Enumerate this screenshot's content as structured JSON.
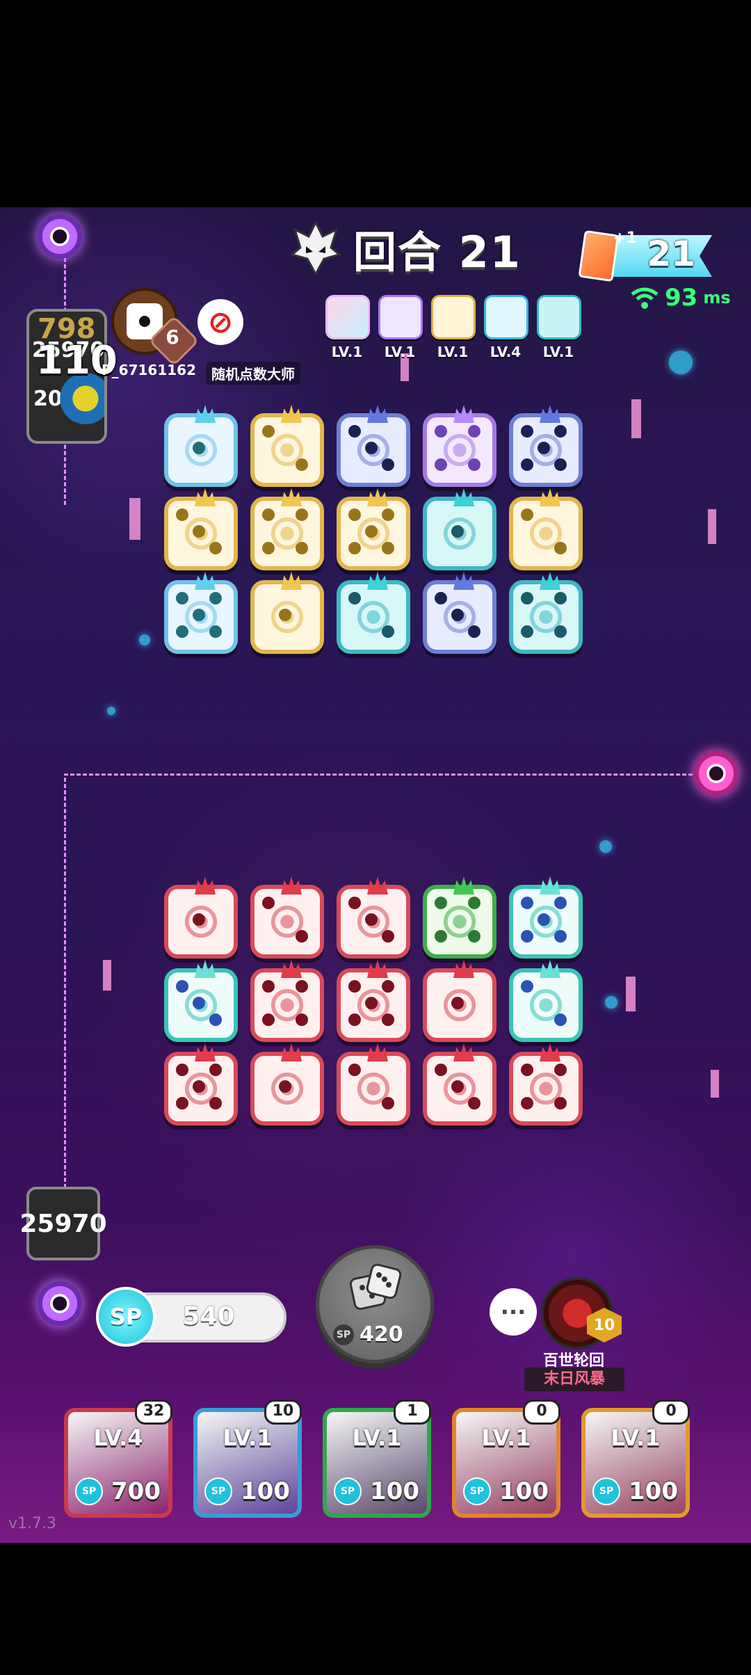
{
  "header": {
    "round_label": "回合 21",
    "card_count": "21",
    "card_bonus": "+1",
    "ping_value": "93",
    "ping_unit": "ms"
  },
  "opponent": {
    "score_top": "798",
    "score_partial": "25970",
    "score_partial_2": "20",
    "hp": "110",
    "rank": "6",
    "name": "P_67161162",
    "title": "随机点数大师",
    "deck_levels": [
      "LV.1",
      "LV.1",
      "LV.1",
      "LV.4",
      "LV.1"
    ],
    "board": [
      [
        "ice",
        "gold",
        "navy",
        "purple",
        "navy"
      ],
      [
        "gold",
        "gold",
        "gold",
        "teal",
        "gold"
      ],
      [
        "ice",
        "gold",
        "teal",
        "navy",
        "teal"
      ]
    ]
  },
  "player": {
    "hp": "25970",
    "sp": "540",
    "roll_cost": "420",
    "emblem_title": "百世轮回",
    "emblem_subtitle": "末日风暴",
    "emblem_level": "10",
    "chat_label": "···",
    "board": [
      [
        "red",
        "red",
        "red",
        "green",
        "mint"
      ],
      [
        "mint",
        "red",
        "red",
        "red",
        "mint"
      ],
      [
        "red",
        "red",
        "red",
        "red",
        "red"
      ]
    ],
    "deck": [
      {
        "level": "LV.4",
        "cost": "700",
        "count": "32",
        "color": "#c83a4e"
      },
      {
        "level": "LV.1",
        "cost": "100",
        "count": "10",
        "color": "#3a9bd6"
      },
      {
        "level": "LV.1",
        "cost": "100",
        "count": "1",
        "color": "#2fa84a"
      },
      {
        "level": "LV.1",
        "cost": "100",
        "count": "0",
        "color": "#e0862a"
      },
      {
        "level": "LV.1",
        "cost": "100",
        "count": "0",
        "color": "#e29a2e"
      }
    ]
  },
  "sp_label": "SP",
  "version": "v1.7.3",
  "colors": {
    "accent_cyan": "#35d6ff",
    "ping_green": "#3dff7a",
    "dashed_path": "#e78cff"
  }
}
